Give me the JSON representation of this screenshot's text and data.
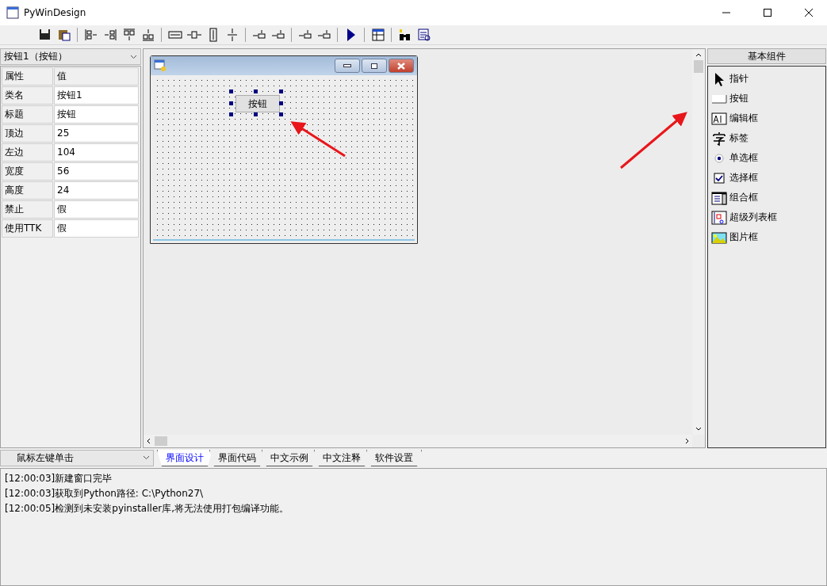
{
  "window": {
    "title": "PyWinDesign"
  },
  "component_selector": {
    "value": "按钮1（按钮）"
  },
  "properties": {
    "columns": [
      "属性",
      "值"
    ],
    "rows": [
      {
        "name": "类名",
        "value": "按钮1"
      },
      {
        "name": "标题",
        "value": "按钮"
      },
      {
        "name": "顶边",
        "value": "25"
      },
      {
        "name": "左边",
        "value": "104"
      },
      {
        "name": "宽度",
        "value": "56"
      },
      {
        "name": "高度",
        "value": "24"
      },
      {
        "name": "禁止",
        "value": "假"
      },
      {
        "name": "使用TTK",
        "value": "假"
      }
    ]
  },
  "event_selector": {
    "value": "鼠标左键单击"
  },
  "designer": {
    "form_button": {
      "label": "按钮",
      "selected": true
    }
  },
  "tabs": [
    {
      "label": "界面设计",
      "selected": true
    },
    {
      "label": "界面代码",
      "selected": false
    },
    {
      "label": "中文示例",
      "selected": false
    },
    {
      "label": "中文注释",
      "selected": false
    },
    {
      "label": "软件设置",
      "selected": false
    }
  ],
  "palette": {
    "title": "基本组件",
    "items": [
      {
        "kind": "pointer",
        "label": "指针"
      },
      {
        "kind": "button",
        "label": "按钮"
      },
      {
        "kind": "edit",
        "label": "编辑框"
      },
      {
        "kind": "label",
        "label": "标签"
      },
      {
        "kind": "radio",
        "label": "单选框"
      },
      {
        "kind": "checkbox",
        "label": "选择框"
      },
      {
        "kind": "combo",
        "label": "组合框"
      },
      {
        "kind": "listview",
        "label": "超级列表框"
      },
      {
        "kind": "picture",
        "label": "图片框"
      }
    ]
  },
  "log": [
    "[12:00:03]新建窗口完毕",
    "[12:00:03]获取到Python路径: C:\\Python27\\",
    "[12:00:05]检测到未安装pyinstaller库,将无法使用打包编译功能。"
  ]
}
